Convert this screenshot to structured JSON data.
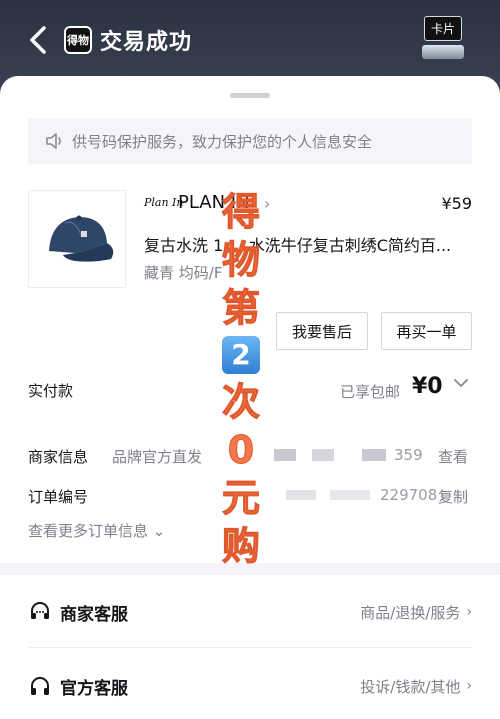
{
  "header": {
    "title": "交易成功",
    "logo_text": "得物",
    "card_button": "卡片"
  },
  "notice": {
    "text": "供号码保护服务，致力保护您的个人信息安全"
  },
  "product": {
    "brand_logo": "Plan In",
    "brand": "PLAN IN",
    "price": "¥59",
    "title": "复古水洗 1 ... 水洗牛仔复古刺绣C简约百...",
    "spec": "藏青 均码/F"
  },
  "actions": {
    "after_sale": "我要售后",
    "rebuy": "再买一单"
  },
  "payment": {
    "label": "实付款",
    "shipping": "已享包邮",
    "amount": "¥0"
  },
  "merchant": {
    "label": "商家信息",
    "value": "品牌官方直发",
    "number_tail": "359",
    "view": "查看"
  },
  "order": {
    "label": "订单编号",
    "number_tail": "229708",
    "copy": "复制"
  },
  "more_info": "查看更多订单信息",
  "services": [
    {
      "title": "商家客服",
      "detail": "商品/退换/服务"
    },
    {
      "title": "官方客服",
      "detail": "投诉/钱款/其他"
    }
  ],
  "promo": {
    "chars_top": [
      "得",
      "物",
      "第"
    ],
    "number": "2",
    "chars_bottom": [
      "次",
      "0",
      "元",
      "购"
    ]
  },
  "colors": {
    "header_bg": "#2b3140",
    "promo": "#f2774a",
    "muted": "#7f7f8e"
  }
}
